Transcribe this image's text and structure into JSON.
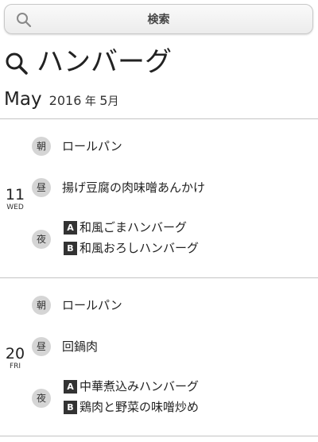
{
  "search": {
    "button_label": "検索",
    "icon": "search-icon"
  },
  "heading": {
    "title": "ハンバーグ",
    "icon": "search-icon"
  },
  "month": {
    "en": "May",
    "year": "2016",
    "year_suffix": "年",
    "month_num": "5",
    "month_suffix": "月"
  },
  "days": [
    {
      "date": "11",
      "weekday": "WED",
      "meals": [
        {
          "badge": "朝",
          "dish": "ロールパン"
        },
        {
          "badge": "昼",
          "dish": "揚げ豆腐の肉味噌あんかけ"
        },
        {
          "badge": "夜",
          "options": [
            {
              "tag": "A",
              "dish": "和風ごまハンバーグ"
            },
            {
              "tag": "B",
              "dish": "和風おろしハンバーグ"
            }
          ]
        }
      ]
    },
    {
      "date": "20",
      "weekday": "FRI",
      "meals": [
        {
          "badge": "朝",
          "dish": "ロールパン"
        },
        {
          "badge": "昼",
          "dish": "回鍋肉"
        },
        {
          "badge": "夜",
          "options": [
            {
              "tag": "A",
              "dish": "中華煮込みハンバーグ"
            },
            {
              "tag": "B",
              "dish": "鶏肉と野菜の味噌炒め"
            }
          ]
        }
      ]
    }
  ]
}
